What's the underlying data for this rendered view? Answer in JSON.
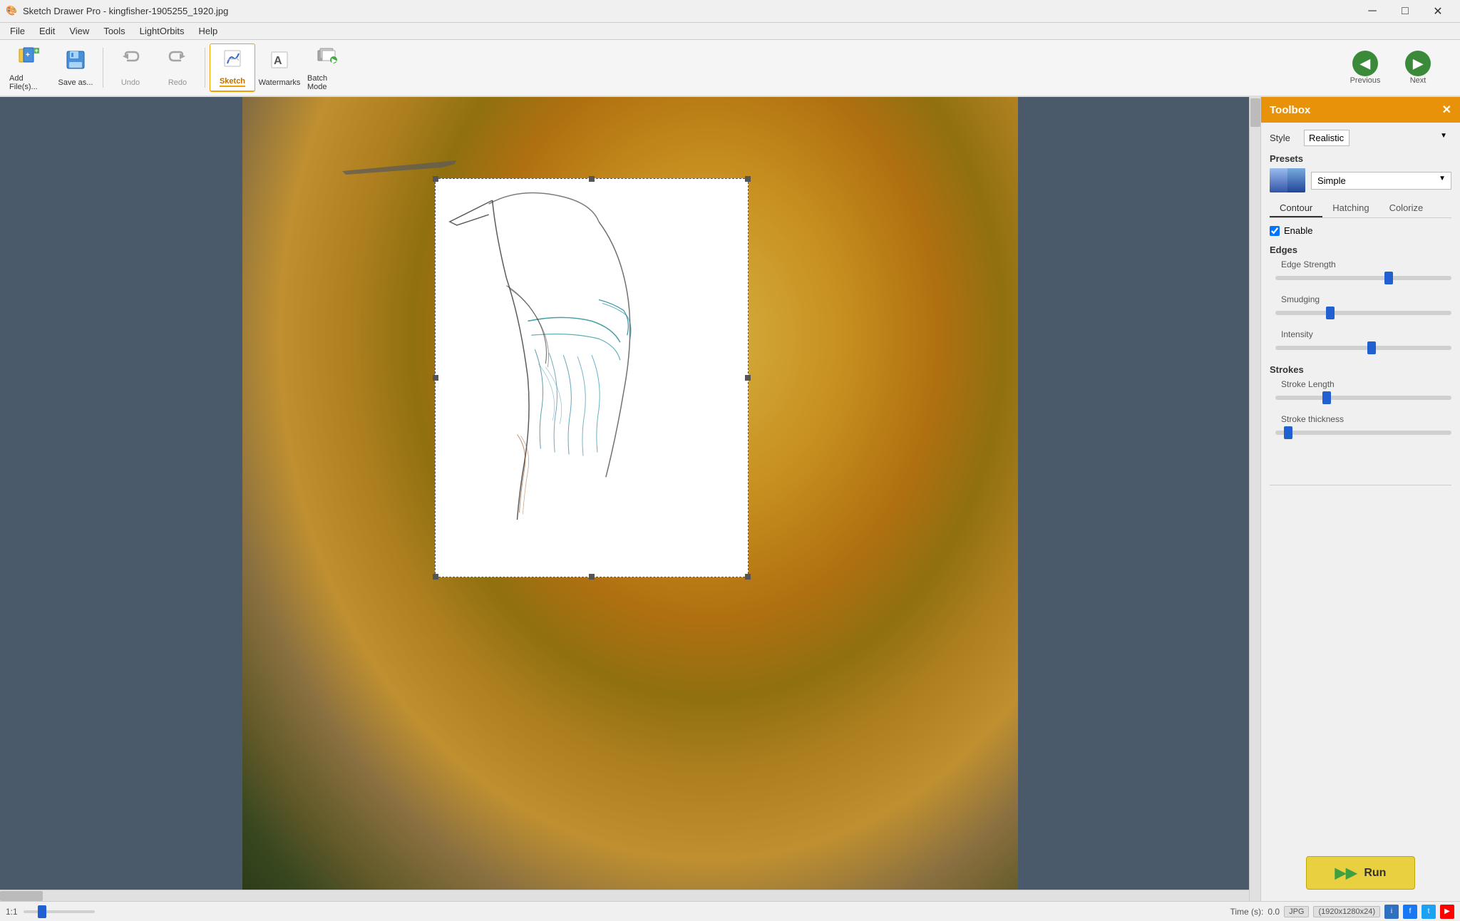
{
  "window": {
    "title": "Sketch Drawer Pro - kingfisher-1905255_1920.jpg",
    "icon": "🎨"
  },
  "titlebar": {
    "minimize": "─",
    "maximize": "□",
    "close": "✕"
  },
  "menu": {
    "items": [
      "File",
      "Edit",
      "View",
      "Tools",
      "LightOrbits",
      "Help"
    ]
  },
  "toolbar": {
    "add_files_label": "Add File(s)...",
    "save_as_label": "Save as...",
    "undo_label": "Undo",
    "redo_label": "Redo",
    "sketch_label": "Sketch",
    "watermarks_label": "Watermarks",
    "batch_mode_label": "Batch Mode"
  },
  "nav": {
    "previous_label": "Previous",
    "next_label": "Next"
  },
  "toolbox": {
    "title": "Toolbox",
    "style_label": "Style",
    "style_value": "Realistic",
    "presets_label": "Presets",
    "presets_value": "Simple",
    "tabs": [
      "Contour",
      "Hatching",
      "Colorize"
    ],
    "active_tab": "Contour",
    "enable_label": "Enable",
    "edges_section": "Edges",
    "edge_strength_label": "Edge Strength",
    "edge_strength_value": 65,
    "smudging_label": "Smudging",
    "smudging_value": 30,
    "intensity_label": "Intensity",
    "intensity_value": 55,
    "strokes_section": "Strokes",
    "stroke_length_label": "Stroke Length",
    "stroke_length_value": 28,
    "stroke_thickness_label": "Stroke thickness",
    "stroke_thickness_value": 5,
    "run_label": "Run"
  },
  "statusbar": {
    "zoom": "1:1",
    "time_label": "Time (s):",
    "time_value": "0.0",
    "format": "JPG",
    "dimensions": "(1920x1280x24)",
    "info_icon": "i",
    "fb_icon": "f",
    "tw_icon": "t",
    "yt_icon": "▶"
  }
}
